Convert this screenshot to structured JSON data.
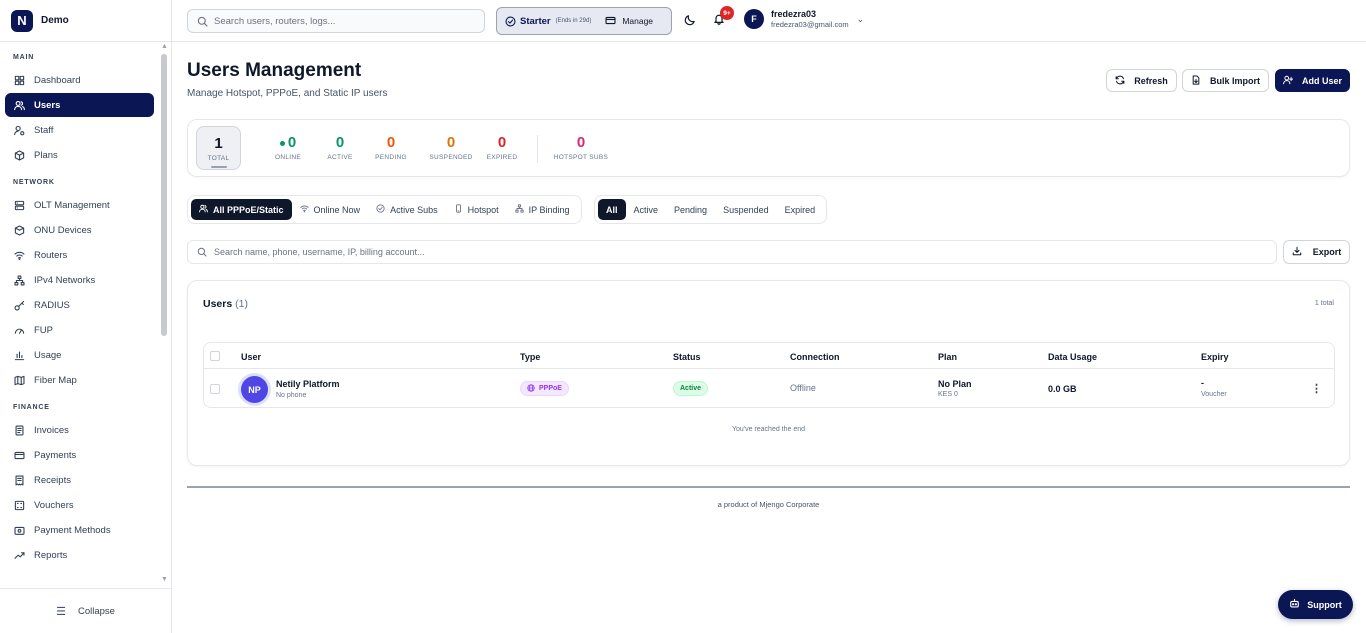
{
  "brand": {
    "logo_letter": "N",
    "name": "Demo"
  },
  "sidebar": {
    "sections": [
      {
        "title": "MAIN",
        "items": [
          {
            "label": "Dashboard",
            "icon": "dashboard-icon"
          },
          {
            "label": "Users",
            "icon": "users-icon",
            "active": true
          },
          {
            "label": "Staff",
            "icon": "staff-icon"
          },
          {
            "label": "Plans",
            "icon": "plans-icon"
          }
        ]
      },
      {
        "title": "NETWORK",
        "items": [
          {
            "label": "OLT Management",
            "icon": "olt-icon"
          },
          {
            "label": "ONU Devices",
            "icon": "onu-icon"
          },
          {
            "label": "Routers",
            "icon": "wifi-icon"
          },
          {
            "label": "IPv4 Networks",
            "icon": "network-icon"
          },
          {
            "label": "RADIUS",
            "icon": "key-icon"
          },
          {
            "label": "FUP",
            "icon": "gauge-icon"
          },
          {
            "label": "Usage",
            "icon": "bar-chart-icon"
          },
          {
            "label": "Fiber Map",
            "icon": "map-icon"
          }
        ]
      },
      {
        "title": "FINANCE",
        "items": [
          {
            "label": "Invoices",
            "icon": "invoice-icon"
          },
          {
            "label": "Payments",
            "icon": "card-icon"
          },
          {
            "label": "Receipts",
            "icon": "receipt-icon"
          },
          {
            "label": "Vouchers",
            "icon": "voucher-icon"
          },
          {
            "label": "Payment Methods",
            "icon": "wallet-icon"
          },
          {
            "label": "Reports",
            "icon": "trend-icon"
          }
        ]
      }
    ],
    "collapse_label": "Collapse"
  },
  "topbar": {
    "search_placeholder": "Search users, routers, logs...",
    "plan_name": "Starter",
    "plan_expiry": "(Ends in 29d)",
    "manage_label": "Manage",
    "notification_count": "9+",
    "user_initial": "F",
    "user_name": "fredezra03",
    "user_email": "fredezra03@gmail.com"
  },
  "page": {
    "title": "Users Management",
    "subtitle": "Manage Hotspot, PPPoE, and Static IP users",
    "refresh_label": "Refresh",
    "bulk_import_label": "Bulk Import",
    "add_user_label": "Add User"
  },
  "stats": [
    {
      "value": "1",
      "label": "TOTAL",
      "color": "#0f172a"
    },
    {
      "value": "0",
      "label": "ONLINE",
      "color": "#059669"
    },
    {
      "value": "0",
      "label": "ACTIVE",
      "color": "#059669"
    },
    {
      "value": "0",
      "label": "PENDING",
      "color": "#ea580c"
    },
    {
      "value": "0",
      "label": "SUSPENDED",
      "color": "#d97706"
    },
    {
      "value": "0",
      "label": "EXPIRED",
      "color": "#dc2626"
    },
    {
      "value": "0",
      "label": "HOTSPOT SUBS",
      "color": "#db2777"
    }
  ],
  "type_filters": [
    {
      "label": "All PPPoE/Static",
      "icon": "users-icon",
      "active": true
    },
    {
      "label": "Online Now",
      "icon": "wifi-icon"
    },
    {
      "label": "Active Subs",
      "icon": "check-circle-icon"
    },
    {
      "label": "Hotspot",
      "icon": "phone-icon"
    },
    {
      "label": "IP Binding",
      "icon": "network-icon"
    }
  ],
  "status_filters": [
    {
      "label": "All",
      "active": true
    },
    {
      "label": "Active"
    },
    {
      "label": "Pending"
    },
    {
      "label": "Suspended"
    },
    {
      "label": "Expired"
    }
  ],
  "user_search_placeholder": "Search name, phone, username, IP, billing account...",
  "export_label": "Export",
  "users_card": {
    "title": "Users",
    "count": "(1)",
    "total": "1 total",
    "columns": [
      "User",
      "Type",
      "Status",
      "Connection",
      "Plan",
      "Data Usage",
      "Expiry"
    ],
    "rows": [
      {
        "initials": "NP",
        "name": "Netily Platform",
        "phone": "No phone",
        "type": "PPPoE",
        "status": "Active",
        "connection": "Offline",
        "plan": "No Plan",
        "plan_price": "KES 0",
        "data_usage": "0.0 GB",
        "expiry": "-",
        "expiry_sub": "Voucher"
      }
    ],
    "end_note": "You've reached the end"
  },
  "footer_note": "a product of Mjengo Corporate",
  "support_label": "Support",
  "colors": {
    "brand": "#0b1654",
    "pppoe": "#9333ea",
    "active": "#15803d"
  }
}
